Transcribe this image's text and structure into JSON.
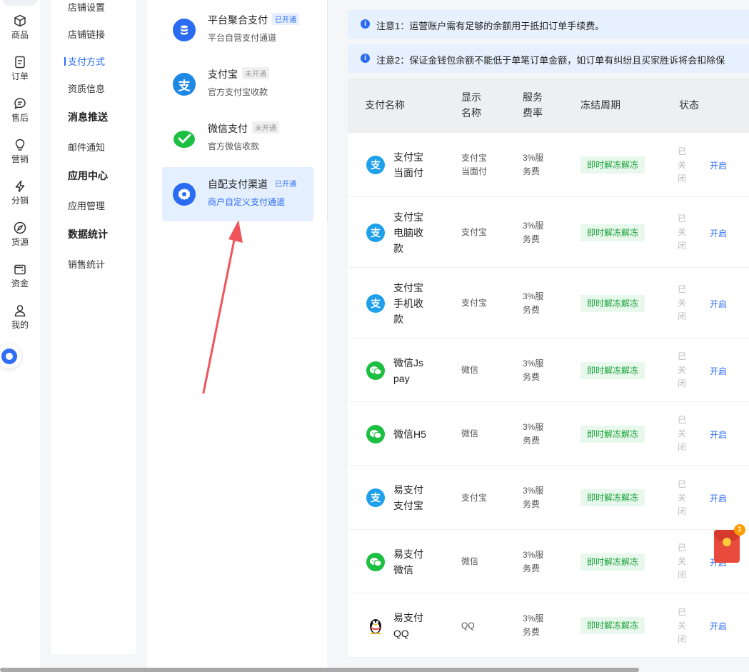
{
  "rail": {
    "items": [
      {
        "label": "商品",
        "icon": "box-icon"
      },
      {
        "label": "订单",
        "icon": "document-icon"
      },
      {
        "label": "售后",
        "icon": "chat-icon"
      },
      {
        "label": "营销",
        "icon": "bulb-icon"
      },
      {
        "label": "分销",
        "icon": "lightning-icon"
      },
      {
        "label": "货源",
        "icon": "compass-icon"
      },
      {
        "label": "资金",
        "icon": "wallet-icon"
      },
      {
        "label": "我的",
        "icon": "user-icon"
      }
    ]
  },
  "subnav": {
    "items": [
      "店铺设置",
      "店铺链接",
      "支付方式",
      "资质信息"
    ],
    "active": "支付方式",
    "groups": [
      {
        "title": "消息推送",
        "items": [
          "邮件通知"
        ]
      },
      {
        "title": "应用中心",
        "items": [
          "应用管理"
        ]
      },
      {
        "title": "数据统计",
        "items": [
          "销售统计"
        ]
      }
    ]
  },
  "channels": [
    {
      "title": "平台聚合支付",
      "tag": "已开通",
      "desc": "平台自营支付通道",
      "icon": "database-icon",
      "color": "#2a6bf2",
      "status": "on"
    },
    {
      "title": "支付宝",
      "tag": "未开通",
      "desc": "官方支付宝收款",
      "icon": "alipay-icon",
      "color": "#1ea0ea",
      "status": "off"
    },
    {
      "title": "微信支付",
      "tag": "未开通",
      "desc": "官方微信收款",
      "icon": "wechat-pay-icon",
      "color": "#1dbf43",
      "status": "off"
    },
    {
      "title": "自配支付渠道",
      "tag": "已开通",
      "desc": "商户自定义支付通道",
      "icon": "gear-icon",
      "color": "#2a6bf2",
      "status": "on"
    }
  ],
  "notices": [
    "注意1：运营账户需有足够的余额用于抵扣订单手续费。",
    "注意2：保证金钱包余额不能低于单笔订单金额，如订单有纠纷且买家胜诉将会扣除保"
  ],
  "table": {
    "headers": {
      "name": "支付名称",
      "display_1": "显示",
      "display_2": "名称",
      "rate_1": "服务",
      "rate_2": "费率",
      "freeze": "冻结周期",
      "status": "状态"
    },
    "rows": [
      {
        "name": "支付宝当面付",
        "display": "支付宝当面付",
        "rate": "3%服务费",
        "freeze": "即时解冻解冻",
        "status": "已关闭",
        "action": "开启",
        "icon": "alipay-icon"
      },
      {
        "name": "支付宝电脑收款",
        "display": "支付宝",
        "rate": "3%服务费",
        "freeze": "即时解冻解冻",
        "status": "已关闭",
        "action": "开启",
        "icon": "alipay-icon"
      },
      {
        "name": "支付宝手机收款",
        "display": "支付宝",
        "rate": "3%服务费",
        "freeze": "即时解冻解冻",
        "status": "已关闭",
        "action": "开启",
        "icon": "alipay-icon"
      },
      {
        "name": "微信Js pay",
        "display": "微信",
        "rate": "3%服务费",
        "freeze": "即时解冻解冻",
        "status": "已关闭",
        "action": "开启",
        "icon": "wechat-icon"
      },
      {
        "name": "微信H5",
        "display": "微信",
        "rate": "3%服务费",
        "freeze": "即时解冻解冻",
        "status": "已关闭",
        "action": "开启",
        "icon": "wechat-icon"
      },
      {
        "name": "易支付支付宝",
        "display": "支付宝",
        "rate": "3%服务费",
        "freeze": "即时解冻解冻",
        "status": "已关闭",
        "action": "开启",
        "icon": "alipay-icon"
      },
      {
        "name": "易支付微信",
        "display": "微信",
        "rate": "3%服务费",
        "freeze": "即时解冻解冻",
        "status": "已关闭",
        "action": "开启",
        "icon": "wechat-icon"
      },
      {
        "name": "易支付QQ",
        "display": "QQ",
        "rate": "3%服务费",
        "freeze": "即时解冻解冻",
        "status": "已关闭",
        "action": "开启",
        "icon": "qq-penguin-icon"
      }
    ]
  },
  "widget": {
    "badge": "1",
    "icon": "red-packet-icon"
  },
  "colors": {
    "accent": "#2a6bf2",
    "success": "#19a33a",
    "annotation_arrow": "#f0545a"
  }
}
